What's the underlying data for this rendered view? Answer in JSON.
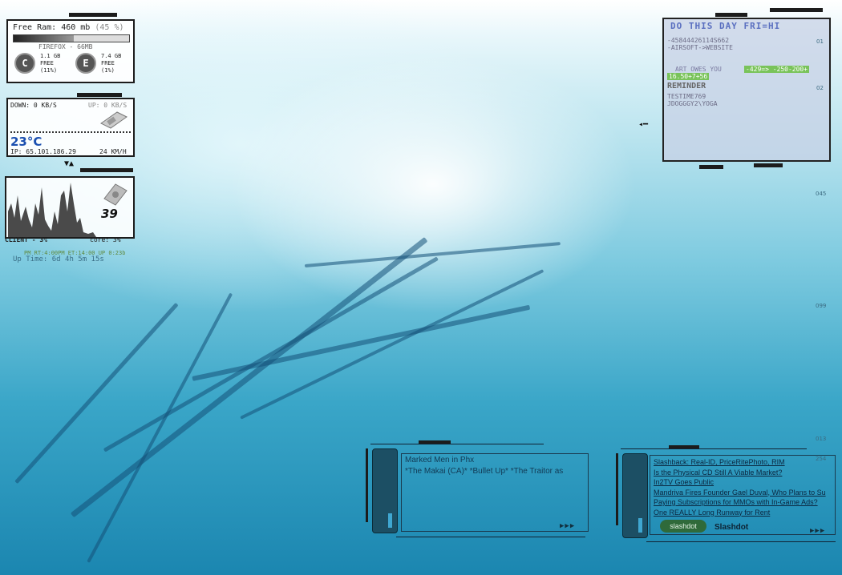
{
  "system": {
    "ram_label": "Free Ram: 460 mb",
    "ram_percent": "(45 %)",
    "ram_used_fraction": 0.52,
    "process": "FIREFOX - 66MB",
    "drives": [
      {
        "letter": "C",
        "free": "1.1 GB",
        "free_label": "FREE",
        "percent": "(11%)"
      },
      {
        "letter": "E",
        "free": "7.4 GB",
        "free_label": "FREE",
        "percent": "(1%)"
      }
    ]
  },
  "network": {
    "down": "DOWN: 0 KB/S",
    "up": "UP: 0 KB/S",
    "temperature": "23°C",
    "ip": "IP: 65.101.186.29",
    "wind": "24 KM/H"
  },
  "cpu": {
    "value": "39",
    "client": "CLIENT - 3%",
    "core": "core: 3%",
    "status_line": "PM RT:4:00PM ET:14:00 UP 0:23b",
    "uptime": "Up Time: 6d 4h 5m 15s"
  },
  "notes": {
    "title": "DO THIS DAY FRI=HI",
    "lines": [
      "-45844426114S662",
      "-AIRSOFT->WEBSITE",
      "  ART OWES YOU",
      "REMINDER",
      "TESTIME769",
      "JDOGGGY2\\YOGA"
    ],
    "highlight1": "-429=> -250-200+",
    "highlight2": "16.50+7+56",
    "scale_marks": [
      "01",
      "02",
      "045",
      "099",
      "013",
      "254"
    ]
  },
  "media": {
    "title": "Marked Men in Phx",
    "tracks": "*The Makai (CA)* *Bullet Up* *The Traitor as"
  },
  "feed": {
    "items": [
      "Slashback: Real-ID, PriceRitePhoto, RIM",
      "Is the Physical CD Still A Viable Market?",
      "In2TV Goes Public",
      "Mandriva Fires Founder Gael Duval, Who Plans to Su",
      "Paying Subscriptions for MMOs with In-Game Ads?",
      "One REALLY Long Runway for Rent"
    ],
    "logo_text": "slashdot",
    "source": "Slashdot"
  },
  "colors": {
    "frame": "#1c1c1c",
    "accent_green": "#6cc24a",
    "wallpaper_deep": "#1b86b0"
  },
  "icons": [
    "network-card-icon",
    "hard-drive-icon",
    "drive-c-icon",
    "drive-e-icon"
  ]
}
